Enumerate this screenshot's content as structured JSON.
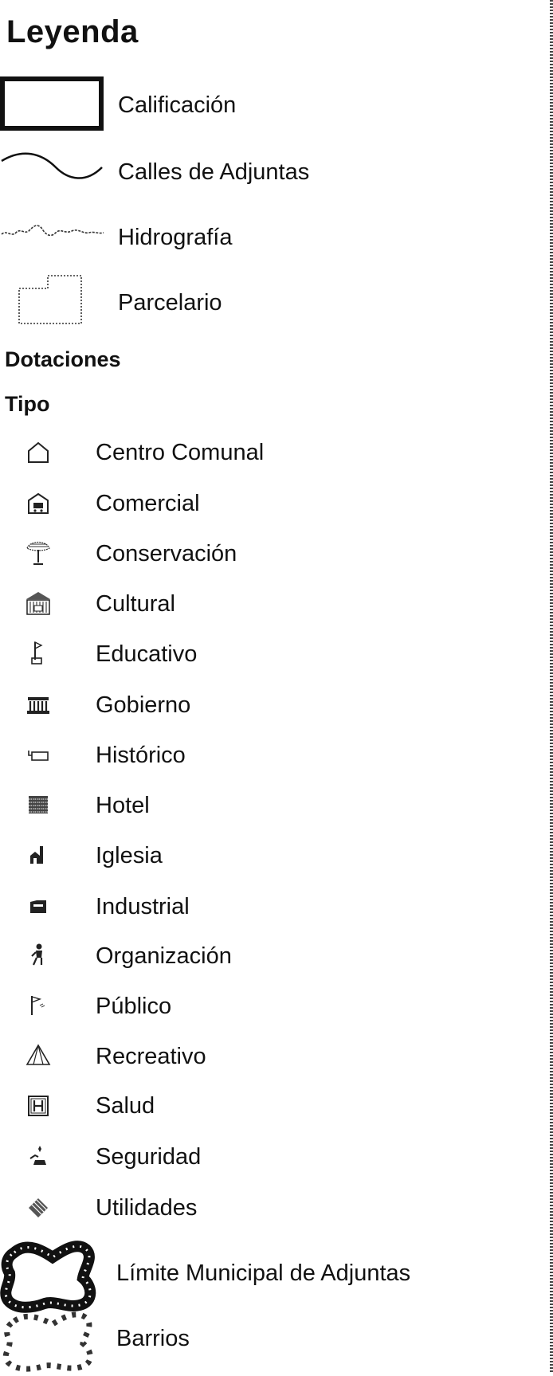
{
  "legend": {
    "title": "Leyenda",
    "layers": {
      "calificacion": "Calificación",
      "calles": "Calles de Adjuntas",
      "hidrografia": "Hidrografía",
      "parcelario": "Parcelario"
    },
    "dotaciones_heading": "Dotaciones",
    "tipo_heading": "Tipo",
    "tipos": [
      {
        "label": "Centro Comunal",
        "icon": "house-outline-icon"
      },
      {
        "label": "Comercial",
        "icon": "shop-cart-icon"
      },
      {
        "label": "Conservación",
        "icon": "tree-icon"
      },
      {
        "label": "Cultural",
        "icon": "museum-icon"
      },
      {
        "label": "Educativo",
        "icon": "school-flag-icon"
      },
      {
        "label": "Gobierno",
        "icon": "government-building-icon"
      },
      {
        "label": "Histórico",
        "icon": "historic-sign-icon"
      },
      {
        "label": "Hotel",
        "icon": "hotel-icon"
      },
      {
        "label": "Iglesia",
        "icon": "church-icon"
      },
      {
        "label": "Industrial",
        "icon": "factory-icon"
      },
      {
        "label": "Organización",
        "icon": "person-icon"
      },
      {
        "label": "Público",
        "icon": "public-flag-icon"
      },
      {
        "label": "Recreativo",
        "icon": "tent-icon"
      },
      {
        "label": "Salud",
        "icon": "hospital-icon"
      },
      {
        "label": "Seguridad",
        "icon": "security-icon"
      },
      {
        "label": "Utilidades",
        "icon": "utilities-icon"
      }
    ],
    "boundaries": {
      "limite": "Límite Municipal de Adjuntas",
      "barrios": "Barrios"
    }
  }
}
